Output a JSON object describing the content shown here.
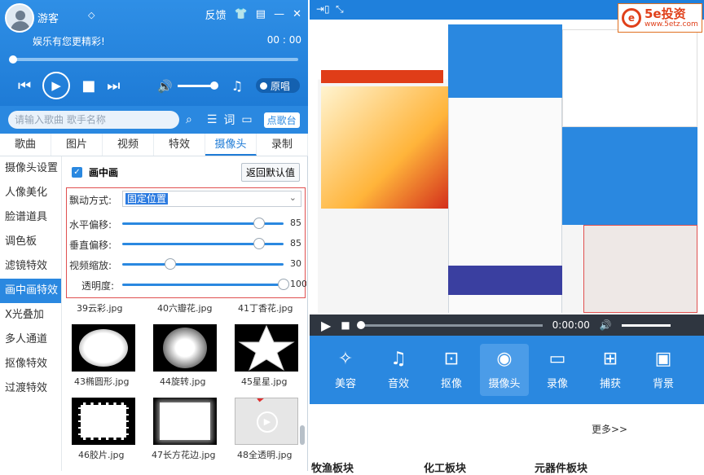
{
  "player": {
    "username": "游客",
    "feedback": "反馈",
    "slogan": "娱乐有您更精彩!",
    "time": "00 : 00",
    "original_sound": "原唱"
  },
  "search": {
    "placeholder": "请输入歌曲 歌手名称",
    "lyrics": "词",
    "point_stage": "点歌台"
  },
  "tabs": [
    "歌曲",
    "图片",
    "视频",
    "特效",
    "摄像头",
    "录制"
  ],
  "sidebar": [
    "摄像头设置",
    "人像美化",
    "脸谱道具",
    "调色板",
    "滤镜特效",
    "画中画特效",
    "X光叠加",
    "多人通道",
    "抠像特效",
    "过渡特效"
  ],
  "pip": {
    "title": "画中画",
    "reset": "返回默认值",
    "motion_label": "飘动方式:",
    "motion_value": "固定位置",
    "sliders": [
      {
        "label": "水平偏移:",
        "value": "85",
        "fraction": 0.85
      },
      {
        "label": "垂直偏移:",
        "value": "85",
        "fraction": 0.85
      },
      {
        "label": "视频缩放:",
        "value": "30",
        "fraction": 0.3
      },
      {
        "label": "透明度:",
        "value": "100",
        "fraction": 1.0
      }
    ]
  },
  "effects_partial": [
    "39云彩.jpg",
    "40六瓣花.jpg",
    "41丁香花.jpg"
  ],
  "effects": [
    "43椭圆形.jpg",
    "44旋转.jpg",
    "45星星.jpg",
    "46胶片.jpg",
    "47长方花边.jpg",
    "48全透明.jpg"
  ],
  "brand": {
    "name": "5e投资",
    "url": "www.5etz.com"
  },
  "video": {
    "time": "0:00:00"
  },
  "tools": [
    "美容",
    "音效",
    "抠像",
    "摄像头",
    "录像",
    "捕获",
    "背景"
  ],
  "web": {
    "more": "更多>>",
    "bottom": [
      "牧渔板块",
      "化工板块",
      "元器件板块"
    ]
  },
  "colors": {
    "accent": "#2a88e0",
    "highlight": "#e05050"
  }
}
